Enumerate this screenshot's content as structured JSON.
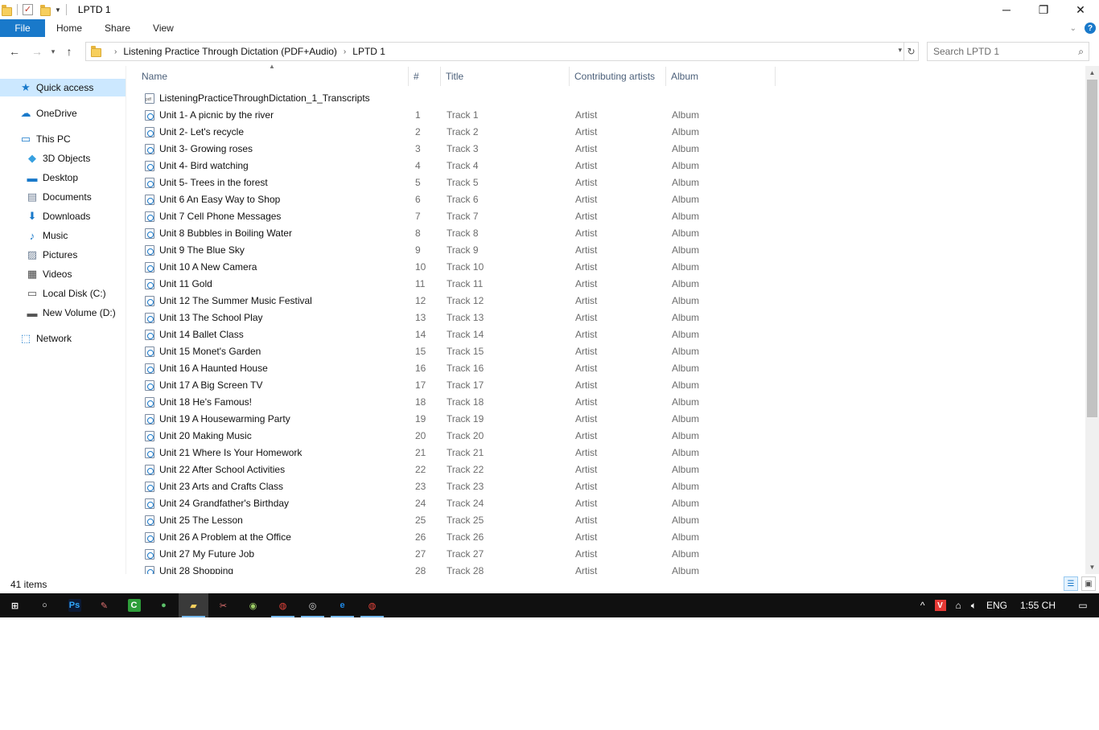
{
  "window": {
    "title": "LPTD 1",
    "minimize_glyph": "─",
    "maximize_glyph": "❐",
    "close_glyph": "✕"
  },
  "ribbon": {
    "tabs": [
      "File",
      "Home",
      "Share",
      "View"
    ],
    "help_glyph": "?"
  },
  "address": {
    "crumbs": [
      "Listening Practice Through Dictation (PDF+Audio)",
      "LPTD 1"
    ],
    "search_placeholder": "Search LPTD 1"
  },
  "nav": {
    "items": [
      {
        "label": "Quick access",
        "icon": "star-icon",
        "glyph": "★",
        "color": "#1979ca"
      },
      {
        "label": "OneDrive",
        "icon": "cloud-icon",
        "glyph": "☁",
        "color": "#1979ca"
      },
      {
        "label": "This PC",
        "icon": "computer-icon",
        "glyph": "▭",
        "color": "#1979ca"
      },
      {
        "label": "3D Objects",
        "icon": "cube-icon",
        "glyph": "◆",
        "color": "#37a0e0"
      },
      {
        "label": "Desktop",
        "icon": "desktop-icon",
        "glyph": "▬",
        "color": "#1979ca"
      },
      {
        "label": "Documents",
        "icon": "document-icon",
        "glyph": "▤",
        "color": "#6d7e94"
      },
      {
        "label": "Downloads",
        "icon": "download-arrow-icon",
        "glyph": "⬇",
        "color": "#1979ca"
      },
      {
        "label": "Music",
        "icon": "music-note-icon",
        "glyph": "♪",
        "color": "#1979ca"
      },
      {
        "label": "Pictures",
        "icon": "picture-icon",
        "glyph": "▨",
        "color": "#6d7e94"
      },
      {
        "label": "Videos",
        "icon": "film-icon",
        "glyph": "▦",
        "color": "#444444"
      },
      {
        "label": "Local Disk (C:)",
        "icon": "drive-icon",
        "glyph": "▭",
        "color": "#555555"
      },
      {
        "label": "New Volume (D:)",
        "icon": "drive-icon",
        "glyph": "▬",
        "color": "#555555"
      },
      {
        "label": "Network",
        "icon": "network-icon",
        "glyph": "⬚",
        "color": "#1979ca"
      }
    ]
  },
  "columns": [
    "Name",
    "#",
    "Title",
    "Contributing artists",
    "Album"
  ],
  "files": [
    {
      "name": "ListeningPracticeThroughDictation_1_Transcripts",
      "num": "",
      "title": "",
      "artist": "",
      "album": "",
      "type": "pdf"
    },
    {
      "name": "Unit 1- A picnic by the river",
      "num": "1",
      "title": "Track 1",
      "artist": "Artist",
      "album": "Album",
      "type": "audio"
    },
    {
      "name": "Unit 2- Let's recycle",
      "num": "2",
      "title": "Track 2",
      "artist": "Artist",
      "album": "Album",
      "type": "audio"
    },
    {
      "name": "Unit 3- Growing roses",
      "num": "3",
      "title": "Track 3",
      "artist": "Artist",
      "album": "Album",
      "type": "audio"
    },
    {
      "name": "Unit 4- Bird watching",
      "num": "4",
      "title": "Track 4",
      "artist": "Artist",
      "album": "Album",
      "type": "audio"
    },
    {
      "name": "Unit 5- Trees in the forest",
      "num": "5",
      "title": "Track 5",
      "artist": "Artist",
      "album": "Album",
      "type": "audio"
    },
    {
      "name": "Unit 6 An Easy Way to Shop",
      "num": "6",
      "title": "Track 6",
      "artist": "Artist",
      "album": "Album",
      "type": "audio"
    },
    {
      "name": "Unit 7 Cell Phone Messages",
      "num": "7",
      "title": "Track 7",
      "artist": "Artist",
      "album": "Album",
      "type": "audio"
    },
    {
      "name": "Unit 8 Bubbles in Boiling Water",
      "num": "8",
      "title": "Track 8",
      "artist": "Artist",
      "album": "Album",
      "type": "audio"
    },
    {
      "name": "Unit 9 The Blue Sky",
      "num": "9",
      "title": "Track 9",
      "artist": "Artist",
      "album": "Album",
      "type": "audio"
    },
    {
      "name": "Unit 10 A New Camera",
      "num": "10",
      "title": "Track 10",
      "artist": "Artist",
      "album": "Album",
      "type": "audio"
    },
    {
      "name": "Unit 11 Gold",
      "num": "11",
      "title": "Track 11",
      "artist": "Artist",
      "album": "Album",
      "type": "audio"
    },
    {
      "name": "Unit 12 The Summer Music Festival",
      "num": "12",
      "title": "Track 12",
      "artist": "Artist",
      "album": "Album",
      "type": "audio"
    },
    {
      "name": "Unit 13 The School Play",
      "num": "13",
      "title": "Track 13",
      "artist": "Artist",
      "album": "Album",
      "type": "audio"
    },
    {
      "name": "Unit 14 Ballet Class",
      "num": "14",
      "title": "Track 14",
      "artist": "Artist",
      "album": "Album",
      "type": "audio"
    },
    {
      "name": "Unit 15 Monet's Garden",
      "num": "15",
      "title": "Track 15",
      "artist": "Artist",
      "album": "Album",
      "type": "audio"
    },
    {
      "name": "Unit 16 A Haunted House",
      "num": "16",
      "title": "Track 16",
      "artist": "Artist",
      "album": "Album",
      "type": "audio"
    },
    {
      "name": "Unit 17 A Big Screen TV",
      "num": "17",
      "title": "Track 17",
      "artist": "Artist",
      "album": "Album",
      "type": "audio"
    },
    {
      "name": "Unit 18 He's Famous!",
      "num": "18",
      "title": "Track 18",
      "artist": "Artist",
      "album": "Album",
      "type": "audio"
    },
    {
      "name": "Unit 19 A Housewarming Party",
      "num": "19",
      "title": "Track 19",
      "artist": "Artist",
      "album": "Album",
      "type": "audio"
    },
    {
      "name": "Unit 20 Making Music",
      "num": "20",
      "title": "Track 20",
      "artist": "Artist",
      "album": "Album",
      "type": "audio"
    },
    {
      "name": "Unit 21 Where Is Your Homework",
      "num": "21",
      "title": "Track 21",
      "artist": "Artist",
      "album": "Album",
      "type": "audio"
    },
    {
      "name": "Unit 22 After School Activities",
      "num": "22",
      "title": "Track 22",
      "artist": "Artist",
      "album": "Album",
      "type": "audio"
    },
    {
      "name": "Unit 23 Arts and Crafts Class",
      "num": "23",
      "title": "Track 23",
      "artist": "Artist",
      "album": "Album",
      "type": "audio"
    },
    {
      "name": "Unit 24 Grandfather's Birthday",
      "num": "24",
      "title": "Track 24",
      "artist": "Artist",
      "album": "Album",
      "type": "audio"
    },
    {
      "name": "Unit 25 The Lesson",
      "num": "25",
      "title": "Track 25",
      "artist": "Artist",
      "album": "Album",
      "type": "audio"
    },
    {
      "name": "Unit 26 A Problem at the Office",
      "num": "26",
      "title": "Track 26",
      "artist": "Artist",
      "album": "Album",
      "type": "audio"
    },
    {
      "name": "Unit 27 My Future Job",
      "num": "27",
      "title": "Track 27",
      "artist": "Artist",
      "album": "Album",
      "type": "audio"
    },
    {
      "name": "Unit 28 Shopping",
      "num": "28",
      "title": "Track 28",
      "artist": "Artist",
      "album": "Album",
      "type": "audio"
    }
  ],
  "status": {
    "item_count": "41 items"
  },
  "taskbar": {
    "apps": [
      {
        "icon": "windows-start-icon",
        "glyph": "⊞",
        "bg": "transparent",
        "fg": "#ffffff",
        "state": ""
      },
      {
        "icon": "cortana-circle-icon",
        "glyph": "○",
        "bg": "transparent",
        "fg": "#ffffff",
        "state": ""
      },
      {
        "icon": "photoshop-icon",
        "glyph": "Ps",
        "bg": "#0b1a35",
        "fg": "#31a8ff",
        "state": ""
      },
      {
        "icon": "paint-icon",
        "glyph": "✎",
        "bg": "transparent",
        "fg": "#e57373",
        "state": ""
      },
      {
        "icon": "camtasia-icon",
        "glyph": "C",
        "bg": "#2e9e3a",
        "fg": "#ffffff",
        "state": ""
      },
      {
        "icon": "chat-app-icon",
        "glyph": "●",
        "bg": "transparent",
        "fg": "#5cc16a",
        "state": ""
      },
      {
        "icon": "file-explorer-icon",
        "glyph": "▰",
        "bg": "transparent",
        "fg": "#f7cf5d",
        "state": "active"
      },
      {
        "icon": "snipping-tool-icon",
        "glyph": "✂",
        "bg": "transparent",
        "fg": "#e57373",
        "state": ""
      },
      {
        "icon": "recorder-icon",
        "glyph": "◉",
        "bg": "transparent",
        "fg": "#9ccc65",
        "state": ""
      },
      {
        "icon": "chrome-icon",
        "glyph": "◍",
        "bg": "transparent",
        "fg": "#e8453c",
        "state": "running"
      },
      {
        "icon": "lens-app-icon",
        "glyph": "◎",
        "bg": "transparent",
        "fg": "#dddddd",
        "state": "running"
      },
      {
        "icon": "edge-icon",
        "glyph": "e",
        "bg": "transparent",
        "fg": "#1e88e5",
        "state": "running"
      },
      {
        "icon": "chrome-icon-2",
        "glyph": "◍",
        "bg": "transparent",
        "fg": "#e8453c",
        "state": "running"
      }
    ],
    "language": "ENG",
    "clock": "1:55 CH"
  }
}
